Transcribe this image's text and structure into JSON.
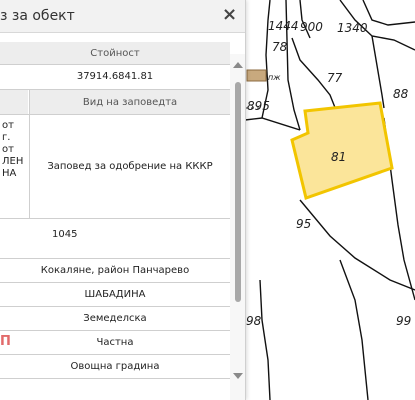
{
  "panel": {
    "title": "з за обект",
    "close_glyph": "×",
    "table": {
      "col_value_header": "Стойност",
      "value_1": "37914.6841.81",
      "col_order_header": "Вид на заповедта",
      "left_lines": [
        "от",
        "г.",
        "от",
        "ЛЕН",
        "НА"
      ],
      "order_type": "Заповед за одобрение на КККР",
      "number": "1045",
      "location": "Кокаляне, район Панчарево",
      "locality": "ШАБАДИНА",
      "territory": "Земеделска",
      "stamp_fragment": "П",
      "ownership": "Частна",
      "usage": "Овощна градина"
    }
  },
  "map": {
    "labels": [
      "1444",
      "900",
      "1340",
      "78",
      "77",
      "88",
      "895",
      "пж",
      "81",
      "95",
      "98",
      "99"
    ],
    "highlight_fill": "#fbe59a",
    "highlight_stroke": "#f2c500"
  }
}
